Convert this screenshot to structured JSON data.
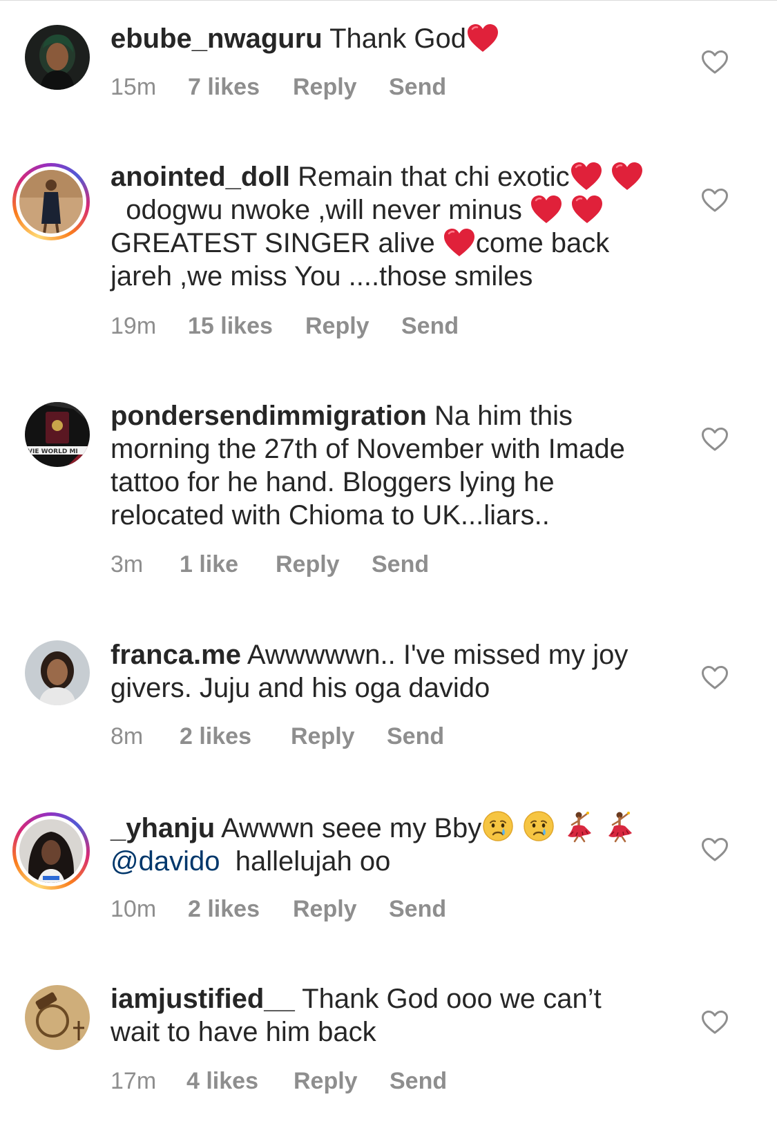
{
  "colors": {
    "text": "#262626",
    "meta": "#8e8e8e",
    "mention": "#00376b",
    "heart_emoji": "#e0213a"
  },
  "comments": [
    {
      "username": "ebube_nwaguru",
      "text_parts": [
        "Thank God"
      ],
      "time": "15m",
      "likes": "7 likes",
      "reply": "Reply",
      "send": "Send"
    },
    {
      "username": "anointed_doll",
      "text_parts": [
        "Remain that chi exotic",
        "odogwu nwoke ,will never minus",
        "GREATEST SINGER alive",
        "come back jareh ,we miss You ....those smiles"
      ],
      "time": "19m",
      "likes": "15 likes",
      "reply": "Reply",
      "send": "Send"
    },
    {
      "username": "pondersendimmigration",
      "text_parts": [
        "Na him this morning the 27th of November with Imade tattoo for he hand. Bloggers lying he relocated with Chioma to UK...liars.."
      ],
      "time": "3m",
      "likes": "1 like",
      "reply": "Reply",
      "send": "Send"
    },
    {
      "username": "franca.me",
      "text_parts": [
        "Awwwwwn.. I've missed my joy givers. Juju and his oga davido"
      ],
      "time": "8m",
      "likes": "2 likes",
      "reply": "Reply",
      "send": "Send"
    },
    {
      "username": "_yhanju",
      "text_parts": [
        "Awwwn seee my Bby",
        "@davido",
        "hallelujah oo"
      ],
      "time": "10m",
      "likes": "2 likes",
      "reply": "Reply",
      "send": "Send"
    },
    {
      "username": "iamjustified__",
      "text_parts": [
        "Thank God ooo we can’t wait to have him back"
      ],
      "time": "17m",
      "likes": "4 likes",
      "reply": "Reply",
      "send": "Send"
    }
  ],
  "icons": {
    "like": "heart-outline-icon",
    "emoji_heart": "red-heart-emoji",
    "emoji_cry": "crying-face-emoji",
    "emoji_dancer": "dancer-emoji"
  },
  "avatar_badge": "VIE WORLD MI"
}
